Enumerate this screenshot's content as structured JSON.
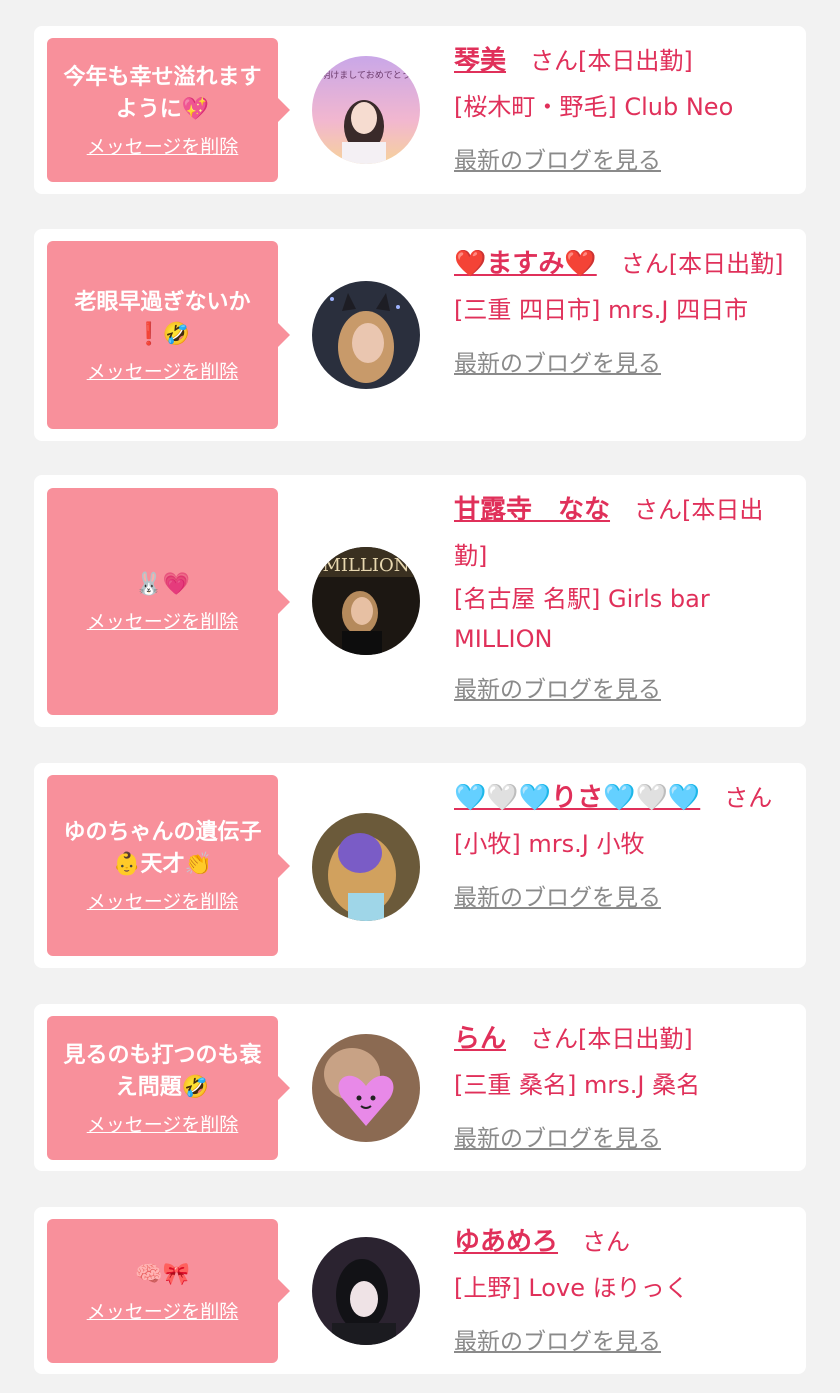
{
  "delete_label": "メッセージを削除",
  "blog_label": "最新のブログを見る",
  "colors": {
    "bubble": "#f8909b",
    "name": "#e0305a",
    "link_gray": "#8a8a8a"
  },
  "items": [
    {
      "message": "今年も幸せ溢れますように💖",
      "name": "琴美",
      "suffix": "さん[本日出勤]",
      "shop": "[桜木町・野毛] Club Neo",
      "avatar_text": "明けましておめでとう"
    },
    {
      "message": "老眼早過ぎないか❗🤣",
      "name": "❤️ますみ❤️",
      "suffix": "さん[本日出勤]",
      "shop": "[三重 四日市] mrs.J 四日市",
      "avatar_text": ""
    },
    {
      "message": "🐰💗",
      "name": "甘露寺　なな",
      "suffix": "さん[本日出勤]",
      "shop": "[名古屋 名駅] Girls bar MILLION",
      "avatar_text": "MILLION"
    },
    {
      "message": "ゆのちゃんの遺伝子👶天才👏",
      "name": "🩵🤍🩵りさ🩵🤍🩵",
      "suffix": "さん",
      "shop": "[小牧] mrs.J 小牧",
      "avatar_text": ""
    },
    {
      "message": "見るのも打つのも衰え問題🤣",
      "name": "らん",
      "suffix": "さん[本日出勤]",
      "shop": "[三重 桑名] mrs.J 桑名",
      "avatar_text": ""
    },
    {
      "message": "🧠🎀",
      "name": "ゆあめろ",
      "suffix": "さん",
      "shop": "[上野] Love ほりっく",
      "avatar_text": ""
    }
  ]
}
